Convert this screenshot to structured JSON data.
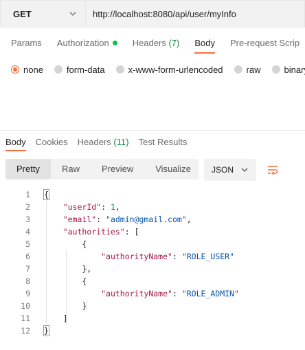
{
  "request": {
    "method": "GET",
    "url": "http://localhost:8080/api/user/myInfo"
  },
  "request_tabs": [
    {
      "label": "Params"
    },
    {
      "label": "Authorization"
    },
    {
      "label": "Headers",
      "count": "(7)"
    },
    {
      "label": "Body"
    },
    {
      "label": "Pre-request Scrip"
    }
  ],
  "body_types": [
    "none",
    "form-data",
    "x-www-form-urlencoded",
    "raw",
    "binary"
  ],
  "body_selected": "none",
  "response_tabs": [
    {
      "label": "Body"
    },
    {
      "label": "Cookies"
    },
    {
      "label": "Headers",
      "count": "(11)"
    },
    {
      "label": "Test Results"
    }
  ],
  "view_modes": [
    "Pretty",
    "Raw",
    "Preview",
    "Visualize"
  ],
  "view_selected": "Pretty",
  "format": "JSON",
  "icons": {
    "method_dropdown": "chevron-down-icon",
    "format_dropdown": "chevron-down-icon",
    "wrap": "wrap-lines-icon",
    "auth_status": "green-dot-icon"
  },
  "colors": {
    "accent": "#ff6c37",
    "count_green": "#0b8a3e",
    "json_key": "#a31547",
    "json_number": "#098658",
    "json_string": "#0451a5"
  },
  "code_lines": [
    {
      "n": "1",
      "parts": [
        {
          "t": "{",
          "c": "p"
        }
      ]
    },
    {
      "n": "2",
      "parts": [
        {
          "t": "    ",
          "c": "p"
        },
        {
          "t": "\"userId\"",
          "c": "k"
        },
        {
          "t": ": ",
          "c": "p"
        },
        {
          "t": "1",
          "c": "num"
        },
        {
          "t": ",",
          "c": "p"
        }
      ]
    },
    {
      "n": "3",
      "parts": [
        {
          "t": "    ",
          "c": "p"
        },
        {
          "t": "\"email\"",
          "c": "k"
        },
        {
          "t": ": ",
          "c": "p"
        },
        {
          "t": "\"admin@gmail.com\"",
          "c": "s"
        },
        {
          "t": ",",
          "c": "p"
        }
      ]
    },
    {
      "n": "4",
      "parts": [
        {
          "t": "    ",
          "c": "p"
        },
        {
          "t": "\"authorities\"",
          "c": "k"
        },
        {
          "t": ": [",
          "c": "p"
        }
      ]
    },
    {
      "n": "5",
      "parts": [
        {
          "t": "        {",
          "c": "p"
        }
      ]
    },
    {
      "n": "6",
      "parts": [
        {
          "t": "            ",
          "c": "p"
        },
        {
          "t": "\"authorityName\"",
          "c": "k"
        },
        {
          "t": ": ",
          "c": "p"
        },
        {
          "t": "\"ROLE_USER\"",
          "c": "s"
        }
      ]
    },
    {
      "n": "7",
      "parts": [
        {
          "t": "        },",
          "c": "p"
        }
      ]
    },
    {
      "n": "8",
      "parts": [
        {
          "t": "        {",
          "c": "p"
        }
      ]
    },
    {
      "n": "9",
      "parts": [
        {
          "t": "            ",
          "c": "p"
        },
        {
          "t": "\"authorityName\"",
          "c": "k"
        },
        {
          "t": ": ",
          "c": "p"
        },
        {
          "t": "\"ROLE_ADMIN\"",
          "c": "s"
        }
      ]
    },
    {
      "n": "10",
      "parts": [
        {
          "t": "        }",
          "c": "p"
        }
      ]
    },
    {
      "n": "11",
      "parts": [
        {
          "t": "    ]",
          "c": "p"
        }
      ]
    },
    {
      "n": "12",
      "parts": [
        {
          "t": "}",
          "c": "p"
        }
      ]
    }
  ]
}
